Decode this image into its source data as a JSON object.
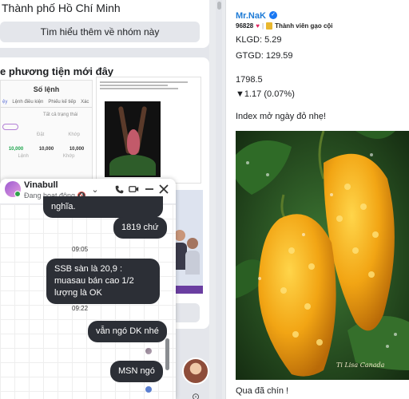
{
  "left": {
    "group_title": "Thành phố Hồ Chí Minh",
    "learn_more_button": "Tìm hiểu thêm về nhóm này",
    "media_title": "e phương tiện mới đây",
    "thumb1": {
      "heading": "Số lệnh",
      "tabs": [
        "ệy",
        "Lệnh điều kiện",
        "Phiếu kế tiếp",
        "Xác"
      ],
      "filter_all": "Tất cả trạng thái",
      "col_a": "Đặt",
      "col_b": "Khớp",
      "val_a": "10,000",
      "val_b": "10,000",
      "val_c": "10,000",
      "sub_a": "Lệnh",
      "sub_b": "Khớp"
    }
  },
  "chat": {
    "contact_name": "Vinabull",
    "status": "Đang hoạt động",
    "messages": [
      {
        "text": "nghĩa.",
        "side": "right"
      },
      {
        "text": "1819 chứ",
        "side": "right"
      }
    ],
    "time1": "09:05",
    "message2": "SSB sàn là 20,9 : muasau bán cao 1/2 lượng là OK",
    "time2": "09:22",
    "message3": "vẫn ngó DK nhé",
    "message4": "MSN ngó"
  },
  "post": {
    "author": "Mr.NaK",
    "points": "96828",
    "badge": "Thành viên gạo cội",
    "klgd": "KLGD: 5.29",
    "gtgd": "GTGD: 129.59",
    "index_value": "1798.5",
    "index_change": "▼1.17 (0.07%)",
    "headline": "Index mở ngày đỏ nhẹ!",
    "image_signature": "Ti Lisa Canada",
    "caption": "Qua đã chín !"
  },
  "colors": {
    "bubble": "#2c2f36",
    "author_link": "#1e7bd6",
    "online": "#31a24c",
    "fruit": "#f2a514"
  }
}
